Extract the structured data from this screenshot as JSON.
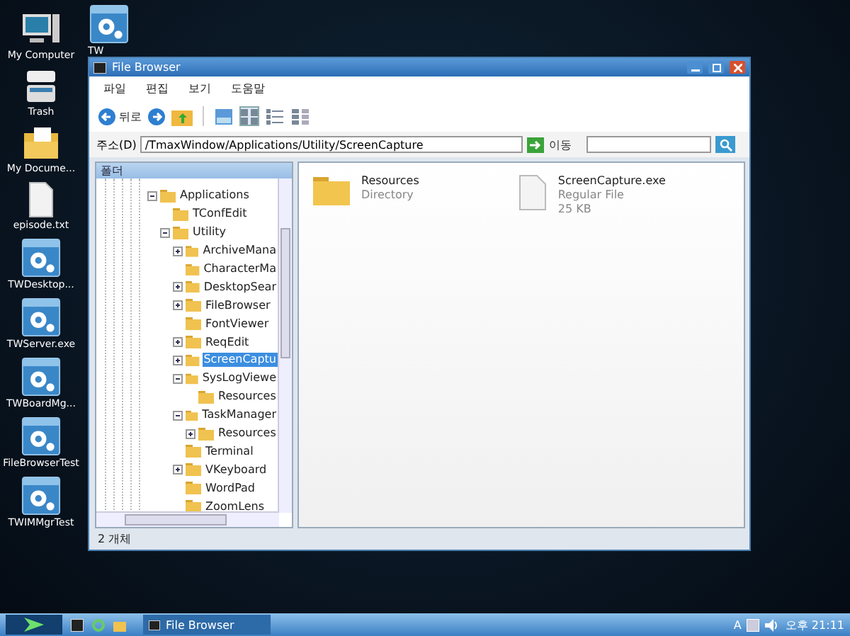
{
  "desktop_icons": [
    {
      "label": "My Computer",
      "kind": "computer"
    },
    {
      "label": "Trash",
      "kind": "trash"
    },
    {
      "label": "My Docume...",
      "kind": "folder"
    },
    {
      "label": "episode.txt",
      "kind": "file"
    },
    {
      "label": "TWDesktop...",
      "kind": "app"
    },
    {
      "label": "TWServer.exe",
      "kind": "app"
    },
    {
      "label": "TWBoardMg...",
      "kind": "app"
    },
    {
      "label": "FileBrowserTest",
      "kind": "app"
    },
    {
      "label": "TWIMMgrTest",
      "kind": "app"
    }
  ],
  "desktop_icons_col2": [
    {
      "label": "TW",
      "kind": "app"
    }
  ],
  "window": {
    "title": "File Browser",
    "menu": [
      "파일",
      "편집",
      "보기",
      "도움말"
    ],
    "toolbar": {
      "back": "뒤로",
      "views": [
        {
          "selected": false
        },
        {
          "selected": true
        },
        {
          "selected": false
        },
        {
          "selected": false
        }
      ]
    },
    "address": {
      "label": "주소(D)",
      "value": "/TmaxWindow/Applications/Utility/ScreenCapture",
      "go": "이동"
    },
    "tree": {
      "header": "폴더",
      "items": [
        {
          "label": "Applications",
          "kind": "branch",
          "expanded": true,
          "selected": false,
          "children": [
            {
              "label": "TConfEdit",
              "kind": "leaf",
              "selected": false
            },
            {
              "label": "Utility",
              "kind": "branch",
              "expanded": true,
              "selected": false,
              "children": [
                {
                  "label": "ArchiveMana",
                  "kind": "branch",
                  "expanded": false,
                  "selected": false
                },
                {
                  "label": "CharacterMa",
                  "kind": "leaf",
                  "selected": false
                },
                {
                  "label": "DesktopSear",
                  "kind": "branch",
                  "expanded": false,
                  "selected": false
                },
                {
                  "label": "FileBrowser",
                  "kind": "branch",
                  "expanded": false,
                  "selected": false
                },
                {
                  "label": "FontViewer",
                  "kind": "leaf",
                  "selected": false
                },
                {
                  "label": "ReqEdit",
                  "kind": "branch",
                  "expanded": false,
                  "selected": false
                },
                {
                  "label": "ScreenCaptu",
                  "kind": "branch",
                  "expanded": false,
                  "selected": true
                },
                {
                  "label": "SysLogViewe",
                  "kind": "branch",
                  "expanded": true,
                  "selected": false,
                  "children": [
                    {
                      "label": "Resources",
                      "kind": "leaf",
                      "selected": false
                    }
                  ]
                },
                {
                  "label": "TaskManager",
                  "kind": "branch",
                  "expanded": true,
                  "selected": false,
                  "children": [
                    {
                      "label": "Resources",
                      "kind": "branch",
                      "expanded": false,
                      "selected": false
                    }
                  ]
                },
                {
                  "label": "Terminal",
                  "kind": "leaf",
                  "selected": false
                },
                {
                  "label": "VKeyboard",
                  "kind": "branch",
                  "expanded": false,
                  "selected": false
                },
                {
                  "label": "WordPad",
                  "kind": "leaf",
                  "selected": false
                },
                {
                  "label": "ZoomLens",
                  "kind": "leaf",
                  "selected": false
                }
              ]
            }
          ]
        }
      ]
    },
    "files": [
      {
        "name": "Resources",
        "type": "Directory",
        "kind": "folder"
      },
      {
        "name": "ScreenCapture.exe",
        "type": "Regular File",
        "size": "25 KB",
        "kind": "file"
      }
    ],
    "status_bar": "2 개체"
  },
  "taskbar": {
    "task": "File Browser",
    "tray_letter": "A",
    "clock": "오후 21:11"
  }
}
